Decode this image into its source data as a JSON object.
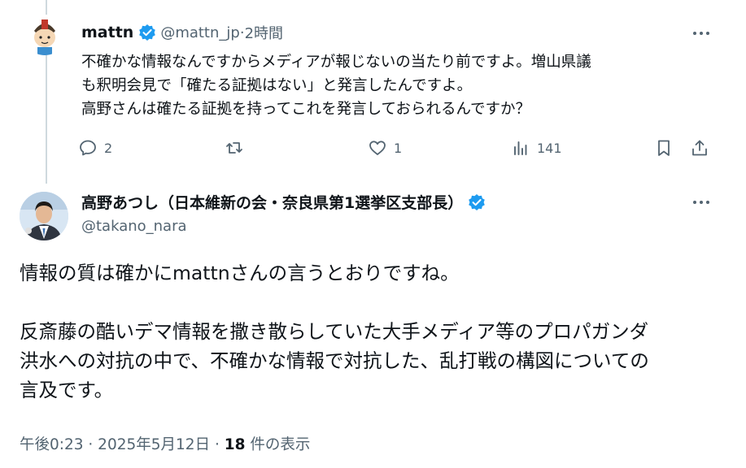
{
  "reply": {
    "name": "mattn",
    "handle": "@mattn_jp",
    "separator": " · ",
    "time": "2時間",
    "text_lines": [
      "不確かな情報なんですからメディアが報じないの当たり前ですよ。増山県議",
      "も釈明会見で「確たる証拠はない」と発言したんですよ。",
      "高野さんは確たる証拠を持ってこれを発言しておられるんですか？"
    ],
    "actions": {
      "replies": "2",
      "likes": "1",
      "views": "141"
    }
  },
  "main": {
    "name": "高野あつし（日本維新の会・奈良県第1選挙区支部長）",
    "handle": "@takano_nara",
    "text_lines": [
      "情報の質は確かにmattnさんの言うとおりですね。",
      "",
      "反斎藤の酷いデマ情報を撒き散らしていた大手メディア等のプロパガンダ",
      "洪水への対抗の中で、不確かな情報で対抗した、乱打戦の構図についての",
      "言及です。"
    ],
    "timestamp": "午後0:23 · 2025年5月12日 · ",
    "views_count": "18",
    "views_label": " 件の表示"
  },
  "colors": {
    "text": "#0f1419",
    "secondary": "#536471",
    "verified": "#1d9bf0",
    "thread_line": "#cfd9de"
  }
}
